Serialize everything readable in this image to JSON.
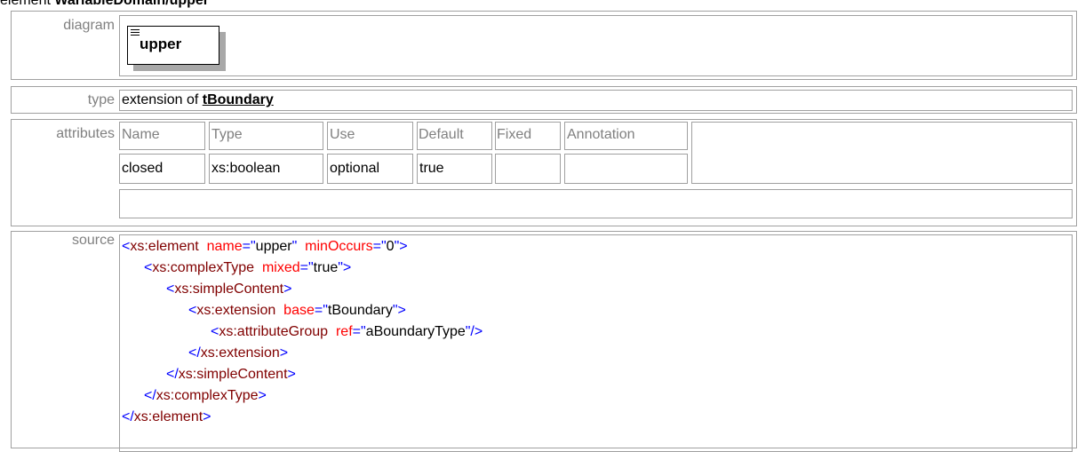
{
  "heading": {
    "prefix": "element ",
    "name": "WariableDomain/upper"
  },
  "diagram": {
    "label": "diagram",
    "element_name": "upper"
  },
  "type_row": {
    "label": "type",
    "prefix": "extension of ",
    "base": "tBoundary"
  },
  "attributes": {
    "label": "attributes",
    "headers": [
      "Name",
      "Type",
      "Use",
      "Default",
      "Fixed",
      "Annotation"
    ],
    "rows": [
      [
        "closed",
        "xs:boolean",
        "optional",
        "true",
        "",
        ""
      ]
    ]
  },
  "source": {
    "label": "source",
    "lines": [
      {
        "parts": [
          {
            "t": "<",
            "c": "blue"
          },
          {
            "t": "xs:element",
            "c": "tag"
          },
          {
            "t": "  name",
            "c": "attr"
          },
          {
            "t": "=\"",
            "c": "blue"
          },
          {
            "t": "upper",
            "c": "val"
          },
          {
            "t": "\"",
            "c": "blue"
          },
          {
            "t": "  minOccurs",
            "c": "attr"
          },
          {
            "t": "=\"",
            "c": "blue"
          },
          {
            "t": "0",
            "c": "val"
          },
          {
            "t": "\">",
            "c": "blue"
          }
        ]
      },
      {
        "parts": [
          {
            "t": "<",
            "c": "blue"
          },
          {
            "t": "xs:complexType",
            "c": "tag"
          },
          {
            "t": "  mixed",
            "c": "attr"
          },
          {
            "t": "=\"",
            "c": "blue"
          },
          {
            "t": "true",
            "c": "val"
          },
          {
            "t": "\">",
            "c": "blue"
          }
        ]
      },
      {
        "parts": [
          {
            "t": "<",
            "c": "blue"
          },
          {
            "t": "xs:simpleContent",
            "c": "tag"
          },
          {
            "t": ">",
            "c": "blue"
          }
        ]
      },
      {
        "parts": [
          {
            "t": "<",
            "c": "blue"
          },
          {
            "t": "xs:extension",
            "c": "tag"
          },
          {
            "t": "  base",
            "c": "attr"
          },
          {
            "t": "=\"",
            "c": "blue"
          },
          {
            "t": "tBoundary",
            "c": "val"
          },
          {
            "t": "\">",
            "c": "blue"
          }
        ]
      },
      {
        "parts": [
          {
            "t": "<",
            "c": "blue"
          },
          {
            "t": "xs:attributeGroup",
            "c": "tag"
          },
          {
            "t": "  ref",
            "c": "attr"
          },
          {
            "t": "=\"",
            "c": "blue"
          },
          {
            "t": "aBoundaryType",
            "c": "val"
          },
          {
            "t": "\"/>",
            "c": "blue"
          }
        ]
      },
      {
        "parts": [
          {
            "t": "</",
            "c": "blue"
          },
          {
            "t": "xs:extension",
            "c": "tag"
          },
          {
            "t": ">",
            "c": "blue"
          }
        ]
      },
      {
        "parts": [
          {
            "t": "</",
            "c": "blue"
          },
          {
            "t": "xs:simpleContent",
            "c": "tag"
          },
          {
            "t": ">",
            "c": "blue"
          }
        ]
      },
      {
        "parts": [
          {
            "t": "</",
            "c": "blue"
          },
          {
            "t": "xs:complexType",
            "c": "tag"
          },
          {
            "t": ">",
            "c": "blue"
          }
        ]
      },
      {
        "parts": [
          {
            "t": "</",
            "c": "blue"
          },
          {
            "t": "xs:element",
            "c": "tag"
          },
          {
            "t": ">",
            "c": "blue"
          }
        ]
      }
    ]
  },
  "colors": {
    "border": "#a0a0a0",
    "label": "#808080",
    "markup": "#0000ff",
    "tag": "#800000",
    "attr": "#ff0000"
  }
}
